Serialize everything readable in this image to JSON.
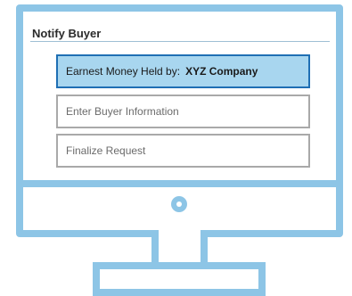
{
  "panel": {
    "title": "Notify Buyer"
  },
  "options": [
    {
      "label": "Earnest Money Held by:",
      "value": "XYZ Company",
      "selected": true
    },
    {
      "label": "Enter Buyer Information",
      "selected": false
    },
    {
      "label": "Finalize Request",
      "selected": false
    }
  ],
  "colors": {
    "monitor_frame": "#8dc5e6",
    "selected_fill": "#a8d6ef",
    "selected_border": "#1f6fb4",
    "option_border": "#a9a9a9"
  },
  "icons": {
    "power": "power-button-icon"
  }
}
